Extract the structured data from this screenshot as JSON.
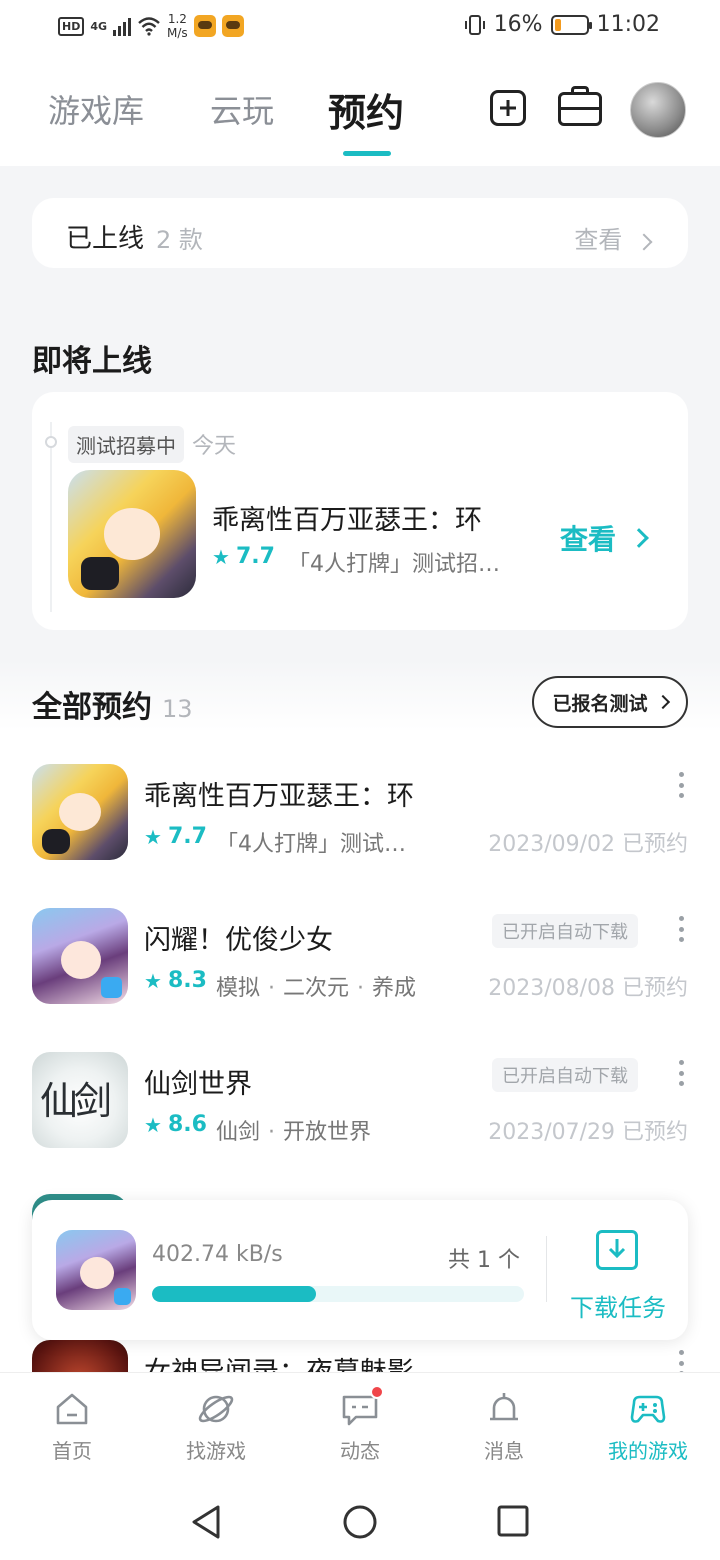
{
  "status_bar": {
    "network": "4G",
    "speed": "1.2\nM/s",
    "battery": "16%",
    "time": "11:02"
  },
  "header": {
    "tabs": [
      {
        "label": "游戏库",
        "active": false
      },
      {
        "label": "云玩",
        "active": false
      },
      {
        "label": "预约",
        "active": true
      }
    ],
    "icons": [
      "add-icon",
      "toolbox-icon"
    ]
  },
  "released": {
    "label": "已上线",
    "count": "2 款",
    "view": "查看"
  },
  "upcoming": {
    "title": "即将上线",
    "tag": "测试招募中",
    "when": "今天",
    "game": {
      "name": "乖离性百万亚瑟王：环",
      "rating": "7.7",
      "desc": "「4人打牌」测试招…",
      "action": "查看"
    }
  },
  "all": {
    "title": "全部预约",
    "count": "13",
    "test_button": "已报名测试",
    "items": [
      {
        "name": "乖离性百万亚瑟王：环",
        "rating": "7.7",
        "desc": "「4人打牌」测试…",
        "date": "2023/09/02 已预约",
        "auto_tag": ""
      },
      {
        "name": "闪耀！优俊少女",
        "rating": "8.3",
        "tags": [
          "模拟",
          "二次元",
          "养成"
        ],
        "date": "2023/08/08 已预约",
        "auto_tag": "已开启自动下载"
      },
      {
        "name": "仙剑世界",
        "rating": "8.6",
        "tags": [
          "仙剑",
          "开放世界"
        ],
        "date": "2023/07/29 已预约",
        "auto_tag": "已开启自动下载"
      },
      {
        "name": "女神异闻录：夜幕魅影",
        "rating": "",
        "desc": "",
        "date": "",
        "auto_tag": ""
      }
    ]
  },
  "download": {
    "speed": "402.74 kB/s",
    "count": "共 1 个",
    "progress": 0.44,
    "label": "下载任务"
  },
  "bottom_nav": [
    {
      "label": "首页",
      "icon": "home-icon",
      "active": false
    },
    {
      "label": "找游戏",
      "icon": "planet-icon",
      "active": false
    },
    {
      "label": "动态",
      "icon": "chat-icon",
      "active": false,
      "badge": true
    },
    {
      "label": "消息",
      "icon": "bell-icon",
      "active": false
    },
    {
      "label": "我的游戏",
      "icon": "gamepad-icon",
      "active": true
    }
  ],
  "colors": {
    "accent": "#1bbcc3",
    "background": "#f4f5f7"
  }
}
